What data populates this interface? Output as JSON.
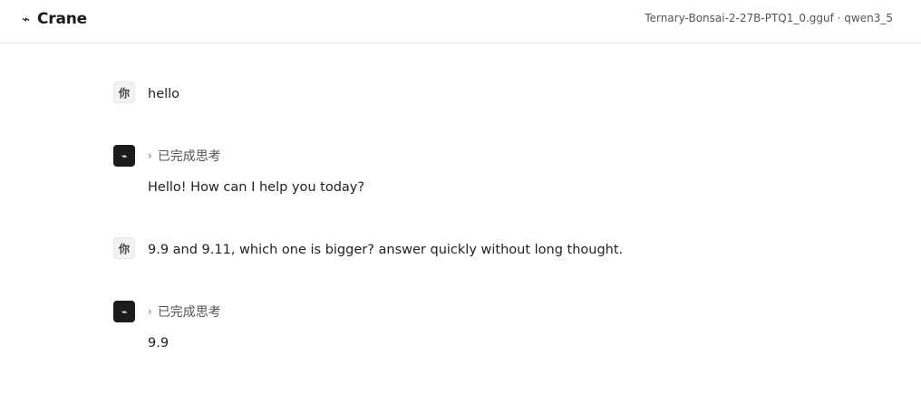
{
  "header": {
    "brand_icon": "⌁",
    "brand_name": "Crane",
    "model_info": "Ternary-Bonsai-2-27B-PTQ1_0.gguf · qwen3_5"
  },
  "messages": [
    {
      "role": "user",
      "avatar": "你",
      "text": "hello"
    },
    {
      "role": "assistant",
      "avatar": "⌁",
      "thinking_label": "已完成思考",
      "thinking_chevron": "›",
      "text": "Hello! How can I help you today?"
    },
    {
      "role": "user",
      "avatar": "你",
      "text": "9.9 and 9.11, which one is bigger? answer quickly without long thought."
    },
    {
      "role": "assistant",
      "avatar": "⌁",
      "thinking_label": "已完成思考",
      "thinking_chevron": "›",
      "text": "9.9"
    }
  ]
}
